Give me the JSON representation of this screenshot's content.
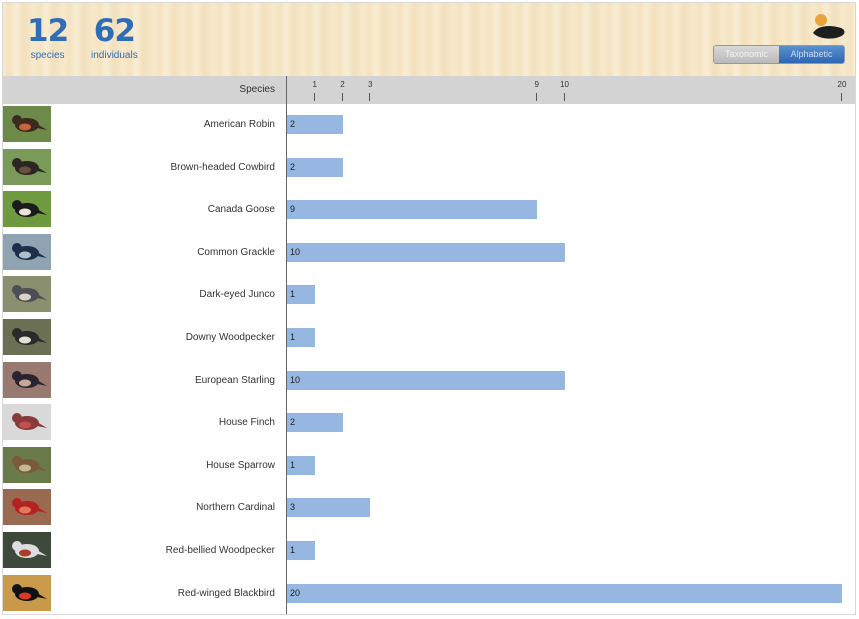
{
  "summary": {
    "species_count": "12",
    "species_label": "species",
    "individuals_count": "62",
    "individuals_label": "individuals"
  },
  "sort_toggle": {
    "options": [
      "Taxonomic",
      "Alphabetic"
    ],
    "selected": "Alphabetic"
  },
  "icons": {
    "logo": "bird-silhouette-icon",
    "thumbnails": "bird-photo"
  },
  "colors": {
    "bar": "#95b7e1",
    "header_text": "#2f6db7"
  },
  "chart_data": {
    "type": "bar",
    "orientation": "horizontal",
    "category_header": "Species",
    "categories": [
      "American Robin",
      "Brown-headed Cowbird",
      "Canada Goose",
      "Common Grackle",
      "Dark-eyed Junco",
      "Downy Woodpecker",
      "European Starling",
      "House Finch",
      "House Sparrow",
      "Northern Cardinal",
      "Red-bellied Woodpecker",
      "Red-winged Blackbird"
    ],
    "values": [
      2,
      2,
      9,
      10,
      1,
      1,
      10,
      2,
      1,
      3,
      1,
      20
    ],
    "xticks": [
      1,
      2,
      3,
      9,
      10,
      20
    ],
    "xlim": [
      0,
      20
    ],
    "grid": false
  }
}
